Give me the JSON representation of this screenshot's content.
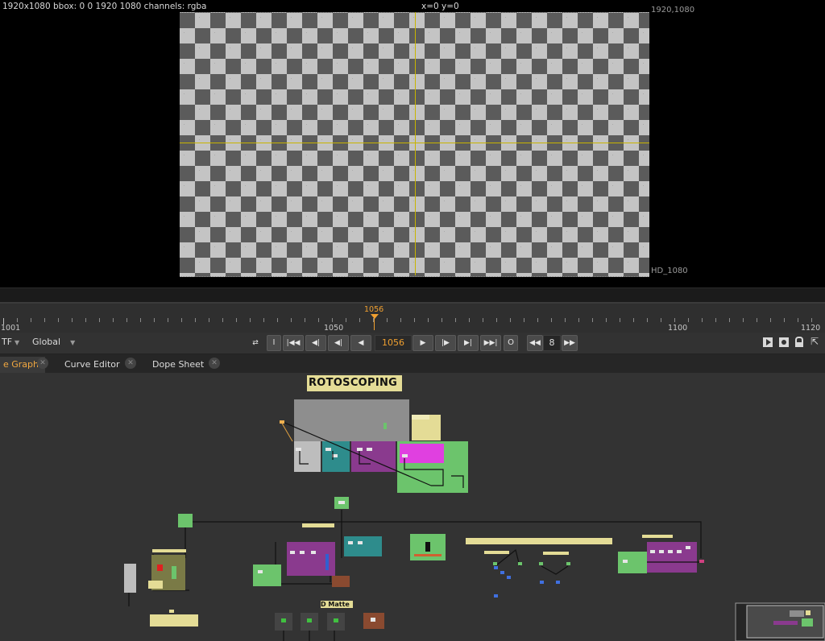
{
  "viewer": {
    "format_top_right": "1920,1080",
    "format_bottom_right": "HD_1080"
  },
  "info_bar": {
    "left": "1920x1080  bbox: 0 0 1920 1080 channels: rgba",
    "coords": "x=0 y=0"
  },
  "timeline": {
    "current_frame": "1056",
    "tick_labels": [
      "1001",
      "1050",
      "1100",
      "1120"
    ]
  },
  "transport": {
    "tf_label": "TF",
    "global_label": "Global",
    "in_label": "I",
    "out_label": "O",
    "frame_value": "1056",
    "increment_value": "8"
  },
  "tabs": [
    {
      "label": "e Graph",
      "active": true
    },
    {
      "label": "Curve Editor",
      "active": false
    },
    {
      "label": "Dope Sheet",
      "active": false
    }
  ],
  "node_graph": {
    "backdrop_title": "ROTOSCOPING",
    "node_label_matte": "D Matte"
  },
  "colors": {
    "accent": "#f0a030",
    "crosshair": "#c8b400",
    "node_green": "#6cc46c",
    "node_purple": "#8a3a8e",
    "node_teal": "#2e8c8c",
    "node_magenta": "#e040e0",
    "backdrop_tan": "#e0d890"
  }
}
